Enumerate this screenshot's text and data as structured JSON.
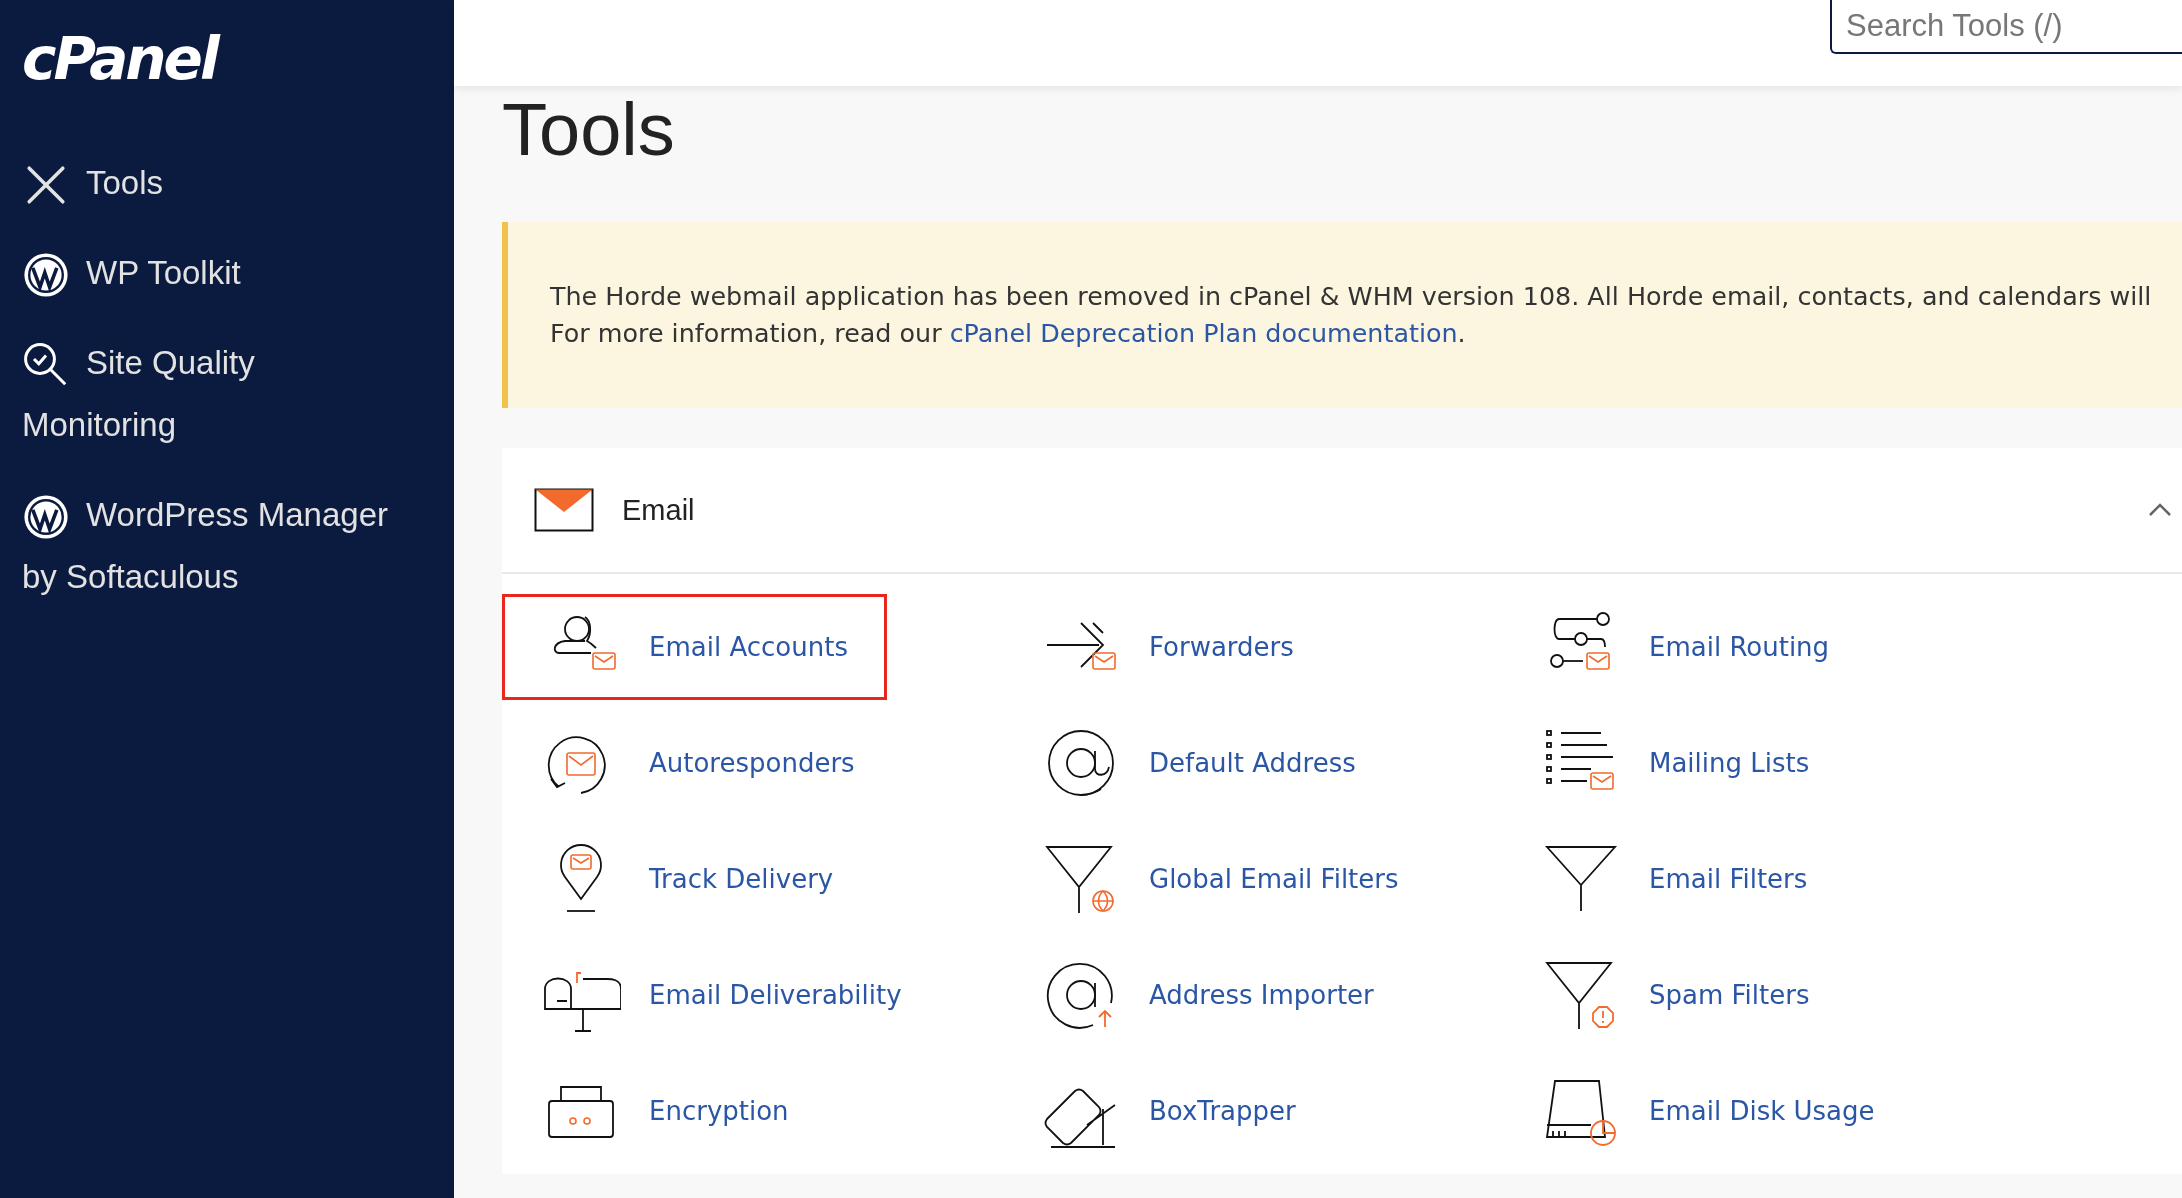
{
  "sidebar": {
    "logo": "cPanel",
    "items": [
      {
        "label": "Tools",
        "kind": "tools"
      },
      {
        "label": "WP Toolkit",
        "kind": "wordpress"
      },
      {
        "label": "Site Quality Monitoring",
        "kind": "quality"
      },
      {
        "label": "WordPress Manager by Softaculous",
        "kind": "wordpress"
      }
    ]
  },
  "search": {
    "placeholder": "Search Tools (/)"
  },
  "page_title": "Tools",
  "notice": {
    "line_1": "The Horde webmail application has been removed in cPanel & WHM version 108. All Horde email, contacts, and calendars will",
    "line_2_prefix": "For more information, read our ",
    "link": "cPanel Deprecation Plan documentation",
    "line_2_suffix": "."
  },
  "section": {
    "title": "Email",
    "expanded": true,
    "tools": [
      {
        "label": "Email Accounts",
        "highlighted": true
      },
      {
        "label": "Forwarders",
        "highlighted": false
      },
      {
        "label": "Email Routing",
        "highlighted": false
      },
      {
        "label": "Autoresponders",
        "highlighted": false
      },
      {
        "label": "Default Address",
        "highlighted": false
      },
      {
        "label": "Mailing Lists",
        "highlighted": false
      },
      {
        "label": "Track Delivery",
        "highlighted": false
      },
      {
        "label": "Global Email Filters",
        "highlighted": false
      },
      {
        "label": "Email Filters",
        "highlighted": false
      },
      {
        "label": "Email Deliverability",
        "highlighted": false
      },
      {
        "label": "Address Importer",
        "highlighted": false
      },
      {
        "label": "Spam Filters",
        "highlighted": false
      },
      {
        "label": "Encryption",
        "highlighted": false
      },
      {
        "label": "BoxTrapper",
        "highlighted": false
      },
      {
        "label": "Email Disk Usage",
        "highlighted": false
      }
    ]
  }
}
